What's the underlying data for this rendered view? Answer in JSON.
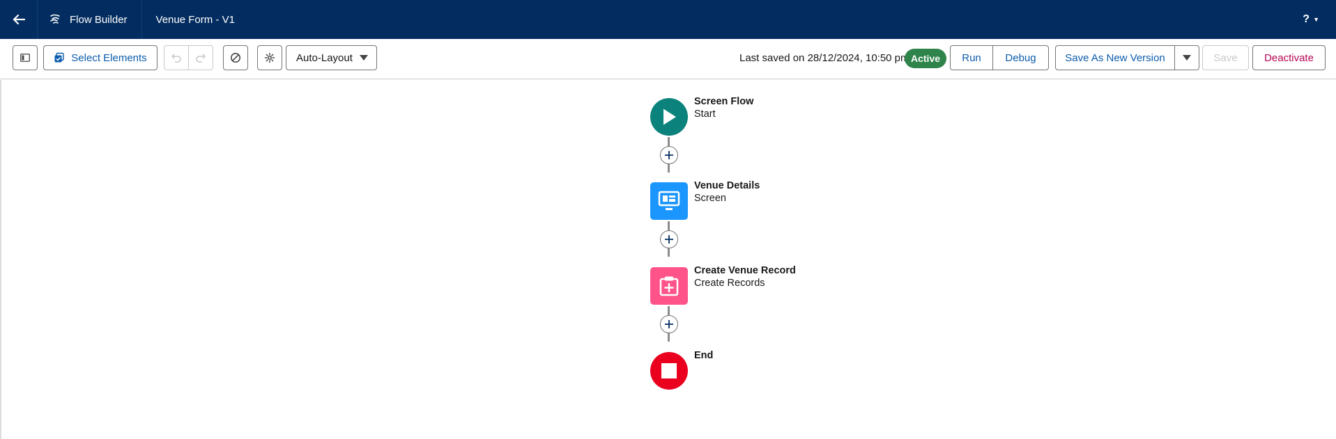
{
  "header": {
    "app_name": "Flow Builder",
    "flow_title": "Venue Form - V1",
    "help_label": "?"
  },
  "toolbar": {
    "select_elements_label": "Select Elements",
    "layout_select_value": "Auto-Layout",
    "last_saved_text": "Last saved on 28/12/2024, 10:50 pm",
    "status_badge": "Active",
    "run_label": "Run",
    "debug_label": "Debug",
    "save_as_new_version_label": "Save As New Version",
    "save_label": "Save",
    "deactivate_label": "Deactivate"
  },
  "flow": {
    "nodes": [
      {
        "name": "Screen Flow",
        "type": "Start",
        "icon": "play-icon",
        "color": "#0b827c"
      },
      {
        "name": "Venue Details",
        "type": "Screen",
        "icon": "screen-icon",
        "color": "#1b96ff"
      },
      {
        "name": "Create Venue Record",
        "type": "Create Records",
        "icon": "create-record-icon",
        "color": "#ff538a"
      },
      {
        "name": "End",
        "type": "",
        "icon": "stop-icon",
        "color": "#ea001e"
      }
    ]
  },
  "colors": {
    "header_bg": "#032d60",
    "brand_blue": "#0b5cab",
    "active_green": "#2e844a",
    "deactivate_red": "#b60554"
  }
}
